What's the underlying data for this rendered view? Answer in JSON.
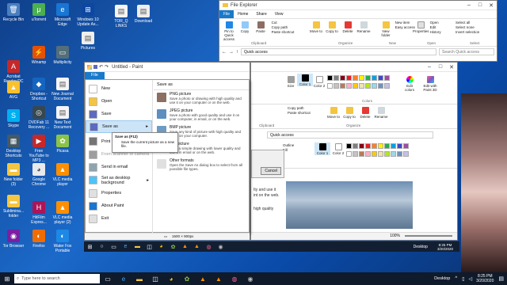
{
  "desktop": {
    "icons": [
      {
        "label": "Recycle Bin",
        "color": "#4a7fbf",
        "glyph": "🗑"
      },
      {
        "label": "Acrobat Reader DC",
        "color": "#c62828",
        "glyph": "A"
      },
      {
        "label": "AVG",
        "color": "#fbc02d",
        "glyph": "▲"
      },
      {
        "label": "Skype",
        "color": "#00aff0",
        "glyph": "S"
      },
      {
        "label": "Desktop Shortcuts",
        "color": "#455a64",
        "glyph": "▦"
      },
      {
        "label": "New folder (3)",
        "color": "#f4c542",
        "glyph": "▬"
      },
      {
        "label": "Sublimina... folder",
        "color": "#f4c542",
        "glyph": "▬"
      },
      {
        "label": "Tor Browser",
        "color": "#7b1fa2",
        "glyph": "◉"
      },
      {
        "label": "uTorrent",
        "color": "#4caf50",
        "glyph": "μ"
      },
      {
        "label": "Winamp",
        "color": "#e65100",
        "glyph": "⚡"
      },
      {
        "label": "Dropbox - Shortcut",
        "color": "#1565c0",
        "glyph": "◆"
      },
      {
        "label": "DVDFab 11 Recovery ...",
        "color": "#37474f",
        "glyph": "◎"
      },
      {
        "label": "Free YouTube to MP3 ...",
        "color": "#c62828",
        "glyph": "▶"
      },
      {
        "label": "Google Chrome",
        "color": "#e8eaed",
        "glyph": "◕"
      },
      {
        "label": "HitFilm Expres...",
        "color": "#ad1457",
        "glyph": "H"
      },
      {
        "label": "Firefox",
        "color": "#ef6c00",
        "glyph": "◐"
      },
      {
        "label": "Microsoft Edge",
        "color": "#1976d2",
        "glyph": "e"
      },
      {
        "label": "Multiplicity",
        "color": "#546e7a",
        "glyph": "▭"
      },
      {
        "label": "New Journal Document",
        "color": "#f5f5f5",
        "glyph": "▤"
      },
      {
        "label": "New Text Document",
        "color": "#f5f5f5",
        "glyph": "▤"
      },
      {
        "label": "Picasa",
        "color": "#8bc34a",
        "glyph": "✿"
      },
      {
        "label": "VLC media player",
        "color": "#ff8f00",
        "glyph": "▲"
      },
      {
        "label": "VLC media player (2)",
        "color": "#ff8f00",
        "glyph": "▲"
      },
      {
        "label": "Water Fox Portable",
        "color": "#1e88e5",
        "glyph": "◐"
      },
      {
        "label": "Windows 10 Update As...",
        "color": "#0d47a1",
        "glyph": "⊞"
      },
      {
        "label": "TOR_Q LINKS",
        "color": "#f5f5f5",
        "glyph": "▤"
      },
      {
        "label": "Download",
        "color": "#eeeeee",
        "glyph": "▤"
      },
      {
        "label": "Pictures",
        "color": "#eeeeee",
        "glyph": "▤"
      },
      {
        "label": "PDF Creator",
        "color": "#d32f2f",
        "glyph": "P"
      },
      {
        "label": "Plex",
        "color": "#263238",
        "glyph": "▶"
      },
      {
        "label": "VLC Open in Tor Browser",
        "color": "#ff8f00",
        "glyph": "▲"
      },
      {
        "label": "Tor Browser Portable",
        "color": "#7b1fa2",
        "glyph": "◉"
      }
    ]
  },
  "explorer": {
    "title": "File Explorer",
    "tabs": [
      "File",
      "Home",
      "Share",
      "View"
    ],
    "clipboard": {
      "pin": "Pin to Quick access",
      "copy": "Copy",
      "paste": "Paste",
      "cut": "Cut",
      "copy_path": "Copy path",
      "paste_shortcut": "Paste shortcut",
      "label": "Clipboard"
    },
    "organize": {
      "move_to": "Move to",
      "copy_to": "Copy to",
      "delete": "Delete",
      "rename": "Rename",
      "label": "Organize"
    },
    "new": {
      "new_folder": "New folder",
      "new_item": "New item",
      "easy_access": "Easy access",
      "label": "New"
    },
    "open": {
      "properties": "Properties",
      "open": "Open",
      "edit": "Edit",
      "history": "History",
      "label": "Open"
    },
    "select": {
      "all": "Select all",
      "none": "Select none",
      "invert": "Invert selection",
      "label": "Select"
    },
    "address": "Quick access",
    "search_placeholder": "Search Quick access"
  },
  "paint_back": {
    "size_label": "Size",
    "color1": "Color 1",
    "color2": "Color 2",
    "edit_colors": "Edit colors",
    "edit_3d": "Edit with Paint 3D",
    "colors_label": "Colors",
    "clipboard_label": "Clipboard",
    "organize_label": "Organize",
    "copy_path": "Copy path",
    "paste_shortcut": "Paste shortcut",
    "cut": "Cut",
    "move_to": "Move to",
    "copy_to": "Copy to",
    "delete": "Delete",
    "rename": "Rename",
    "address": "Quick access",
    "outline": "Outline",
    "fill": "Fill",
    "dialog_label": "Cancel",
    "zoom": "100%",
    "body_lines": [
      "Ity and use it",
      "int on the web.",
      "high quality"
    ]
  },
  "paint": {
    "title": "Untitled - Paint",
    "file_tab": "File",
    "menu_items": [
      {
        "label": "New",
        "color": "#ffffff"
      },
      {
        "label": "Open",
        "color": "#f4c542"
      },
      {
        "label": "Save",
        "color": "#5c6bc0"
      },
      {
        "label": "Save as",
        "color": "#5c6bc0"
      },
      {
        "label": "Print",
        "color": "#757575"
      },
      {
        "label": "From scanner or camera",
        "color": "#9e9e9e"
      },
      {
        "label": "Send in email",
        "color": "#90a4ae"
      },
      {
        "label": "Set as desktop background",
        "color": "#4fc3f7"
      },
      {
        "label": "Properties",
        "color": "#e0e0e0"
      },
      {
        "label": "About Paint",
        "color": "#1976d2"
      },
      {
        "label": "Exit",
        "color": "#e0e0e0"
      }
    ],
    "save_as_header": "Save as",
    "save_as_options": [
      {
        "title": "PNG picture",
        "desc": "Save a photo or drawing with high quality and use it on your computer or on the web.",
        "color": "#8d6e63"
      },
      {
        "title": "JPEG picture",
        "desc": "Save a photo with good quality and use it on your computer, in email, or on the web.",
        "color": "#5d8fbf"
      },
      {
        "title": "BMP picture",
        "desc": "Save any kind of picture with high quality and use it on your computer.",
        "color": "#6d9bc3"
      },
      {
        "title": "GIF picture",
        "desc": "Save a simple drawing with lower quality and use it in email or on the web.",
        "color": "#7cb342"
      },
      {
        "title": "Other formats",
        "desc": "Open the Save As dialog box to select from all possible file types.",
        "color": "#e0e0e0"
      }
    ],
    "tooltip_title": "Save as (F12)",
    "tooltip_desc": "Save the current picture as a new file.",
    "status_size": "1600 × 900px",
    "zoom": "100%"
  },
  "inner_taskbar": {
    "search": "Desktop",
    "time": "8:25 PM",
    "date": "3/20/2020"
  },
  "taskbar": {
    "search_placeholder": "Type here to search",
    "desktop_label": "Desktop",
    "time": "8:25 PM",
    "date": "3/20/2020"
  },
  "colors": {
    "accent": "#1979ca",
    "taskbar": "#0f1a2b",
    "desktop": "#1b69c9"
  }
}
